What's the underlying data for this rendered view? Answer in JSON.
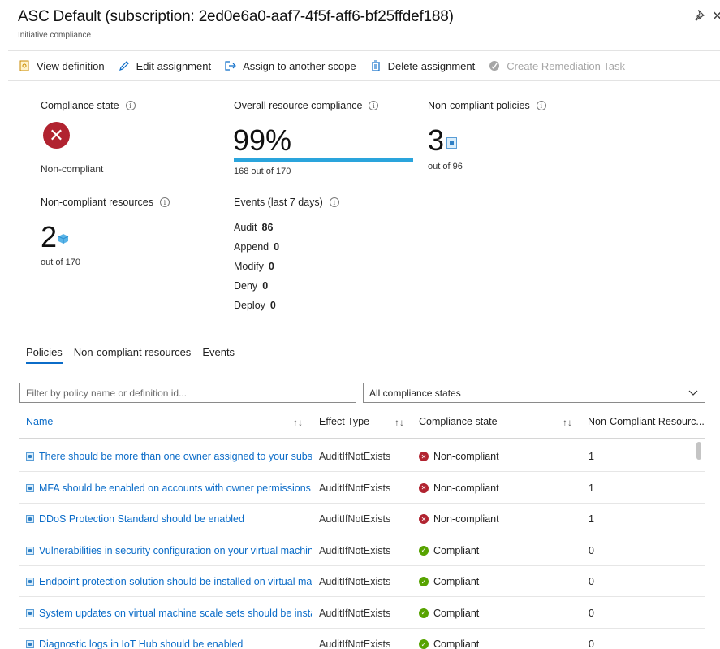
{
  "header": {
    "title": "ASC Default (subscription: 2ed0e6a0-aaf7-4f5f-aff6-bf25ffdef188)",
    "subtitle": "Initiative compliance"
  },
  "toolbar": {
    "buttons": [
      {
        "label": "View definition",
        "icon": "document-icon",
        "enabled": true
      },
      {
        "label": "Edit assignment",
        "icon": "pencil-icon",
        "enabled": true
      },
      {
        "label": "Assign to another scope",
        "icon": "arrow-right-box-icon",
        "enabled": true
      },
      {
        "label": "Delete assignment",
        "icon": "trash-icon",
        "enabled": true
      },
      {
        "label": "Create Remediation Task",
        "icon": "remediate-icon",
        "enabled": false
      }
    ]
  },
  "summary": {
    "compliance_state_label": "Compliance state",
    "compliance_state_value": "Non-compliant",
    "overall_label": "Overall resource compliance",
    "overall_percent_text": "99%",
    "overall_percent": 0.99,
    "overall_detail": "168 out of 170",
    "noncompliant_policies_label": "Non-compliant policies",
    "noncompliant_policies_value": "3",
    "noncompliant_policies_detail": "out of 96",
    "noncompliant_resources_label": "Non-compliant resources",
    "noncompliant_resources_value": "2",
    "noncompliant_resources_detail": "out of 170",
    "events_label": "Events (last 7 days)",
    "events": [
      {
        "name": "Audit",
        "count": "86"
      },
      {
        "name": "Append",
        "count": "0"
      },
      {
        "name": "Modify",
        "count": "0"
      },
      {
        "name": "Deny",
        "count": "0"
      },
      {
        "name": "Deploy",
        "count": "0"
      }
    ]
  },
  "tabs": [
    {
      "label": "Policies",
      "active": true
    },
    {
      "label": "Non-compliant resources",
      "active": false
    },
    {
      "label": "Events",
      "active": false
    }
  ],
  "filter": {
    "placeholder": "Filter by policy name or definition id...",
    "state_select": "All compliance states"
  },
  "table": {
    "columns": [
      "Name",
      "Effect Type",
      "Compliance state",
      "Non-Compliant Resourc..."
    ],
    "rows": [
      {
        "name": "There should be more than one owner assigned to your subscri...",
        "effect": "AuditIfNotExists",
        "state": "Non-compliant",
        "compliant": false,
        "count": "1"
      },
      {
        "name": "MFA should be enabled on accounts with owner permissions on...",
        "effect": "AuditIfNotExists",
        "state": "Non-compliant",
        "compliant": false,
        "count": "1"
      },
      {
        "name": "DDoS Protection Standard should be enabled",
        "effect": "AuditIfNotExists",
        "state": "Non-compliant",
        "compliant": false,
        "count": "1"
      },
      {
        "name": "Vulnerabilities in security configuration on your virtual machine ...",
        "effect": "AuditIfNotExists",
        "state": "Compliant",
        "compliant": true,
        "count": "0"
      },
      {
        "name": "Endpoint protection solution should be installed on virtual mach...",
        "effect": "AuditIfNotExists",
        "state": "Compliant",
        "compliant": true,
        "count": "0"
      },
      {
        "name": "System updates on virtual machine scale sets should be installed",
        "effect": "AuditIfNotExists",
        "state": "Compliant",
        "compliant": true,
        "count": "0"
      },
      {
        "name": "Diagnostic logs in IoT Hub should be enabled",
        "effect": "AuditIfNotExists",
        "state": "Compliant",
        "compliant": true,
        "count": "0"
      }
    ]
  },
  "colors": {
    "accent": "#0b6cc8",
    "error": "#b12330",
    "success": "#57a300",
    "progress": "#2aa4dc"
  }
}
